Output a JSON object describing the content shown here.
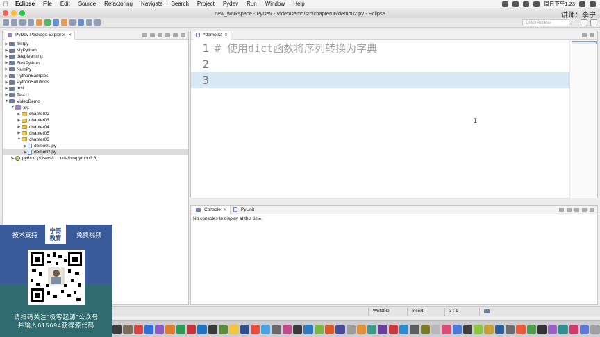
{
  "menubar": {
    "app": "Eclipse",
    "items": [
      "File",
      "Edit",
      "Source",
      "Refactoring",
      "Navigate",
      "Search",
      "Project",
      "Pydev",
      "Run",
      "Window",
      "Help"
    ],
    "clock": "周日下午1:23"
  },
  "window": {
    "title": "new_workspace - PyDev - VideoDemo/src/chapter06/demo02.py - Eclipse",
    "teacher_label": "讲师：李宁"
  },
  "toolbar": {
    "quick_access_placeholder": "Quick Access"
  },
  "explorer": {
    "tab_label": "PyDev Package Explorer",
    "items": [
      {
        "label": "firstpy",
        "depth": 0,
        "kind": "proj",
        "arrow": "▶"
      },
      {
        "label": "MyPython",
        "depth": 0,
        "kind": "proj",
        "arrow": "▶"
      },
      {
        "label": "deeplearning",
        "depth": 0,
        "kind": "proj",
        "arrow": "▶"
      },
      {
        "label": "FirstPython",
        "depth": 0,
        "kind": "proj",
        "arrow": "▶"
      },
      {
        "label": "NumPy",
        "depth": 0,
        "kind": "proj",
        "arrow": "▶"
      },
      {
        "label": "PythonSamples",
        "depth": 0,
        "kind": "proj",
        "arrow": "▶"
      },
      {
        "label": "PythonSolutions",
        "depth": 0,
        "kind": "proj",
        "arrow": "▶"
      },
      {
        "label": "test",
        "depth": 0,
        "kind": "proj",
        "arrow": "▶"
      },
      {
        "label": "Test11",
        "depth": 0,
        "kind": "proj",
        "arrow": "▶"
      },
      {
        "label": "VideoDemo",
        "depth": 0,
        "kind": "proj",
        "arrow": "▼"
      },
      {
        "label": "src",
        "depth": 1,
        "kind": "pkg",
        "arrow": "▼"
      },
      {
        "label": "chapter02",
        "depth": 2,
        "kind": "folder",
        "arrow": "▶"
      },
      {
        "label": "chapter03",
        "depth": 2,
        "kind": "folder",
        "arrow": "▶"
      },
      {
        "label": "chapter04",
        "depth": 2,
        "kind": "folder",
        "arrow": "▶"
      },
      {
        "label": "chapter05",
        "depth": 2,
        "kind": "folder",
        "arrow": "▶"
      },
      {
        "label": "chapter06",
        "depth": 2,
        "kind": "folder",
        "arrow": "▼"
      },
      {
        "label": "demo01.py",
        "depth": 3,
        "kind": "py",
        "arrow": "▶"
      },
      {
        "label": "demo02.py",
        "depth": 3,
        "kind": "py",
        "arrow": "▶",
        "selected": true
      },
      {
        "label": "python  (/Users/l ... nda/bin/python3.6)",
        "depth": 1,
        "kind": "pyi",
        "arrow": "▶"
      }
    ]
  },
  "editor": {
    "tab_label": "*demo02",
    "lines": [
      {
        "num": "1",
        "text": "# 使用dict函数将序列转换为字典"
      },
      {
        "num": "2",
        "text": ""
      },
      {
        "num": "3",
        "text": "",
        "current": true
      }
    ]
  },
  "console": {
    "tab_label": "Console",
    "tab2_label": "PyUnit",
    "message": "No consoles to display at this time."
  },
  "status": {
    "writable": "Writable",
    "insert": "Insert",
    "position": "3 : 1"
  },
  "promo": {
    "tag_left": "技术支持",
    "tag_right": "免费视频",
    "logo_line1": "宁哥",
    "logo_line2": "教育",
    "caption_line1": "请扫码关注“极客起源”公众号",
    "caption_line2": "并输入615694获得源代码"
  },
  "colors": {
    "selection": "#dcdcdc",
    "current_line": "#d9e8f5",
    "promo_blue": "#3a5b9a",
    "promo_teal": "#2f6b6f"
  }
}
